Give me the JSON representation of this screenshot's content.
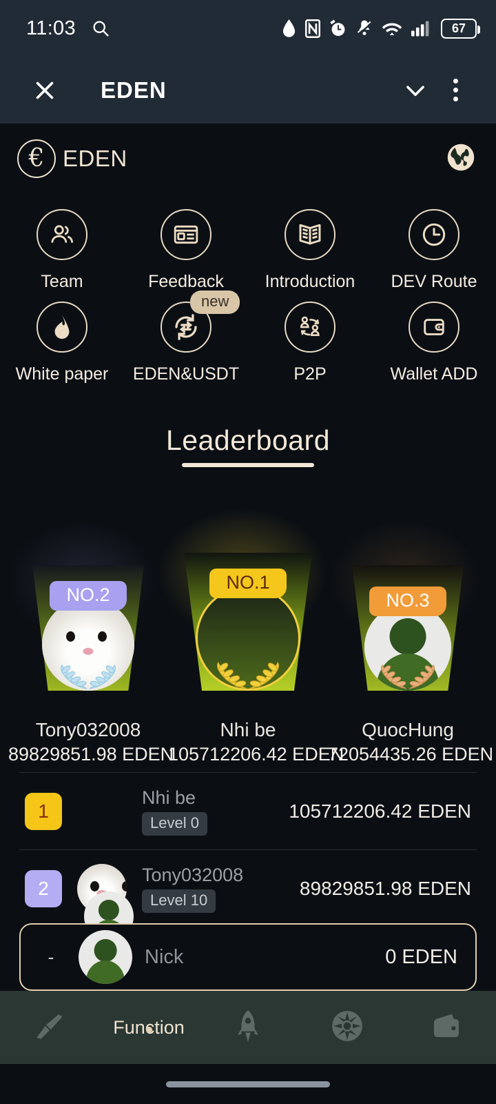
{
  "statusbar": {
    "time": "11:03",
    "search_icon": "search-icon",
    "icons": [
      "water-drop-icon",
      "nfc-icon",
      "alarm-clock-icon",
      "bell-muted-icon",
      "wifi-icon",
      "cellular-signal-icon"
    ],
    "battery_level": "67"
  },
  "window": {
    "close_label": "✕",
    "title": "EDEN",
    "chevron_icon": "chevron-down-icon",
    "menu_icon": "more-vertical-icon"
  },
  "appheader": {
    "logo_glyph": "€",
    "brand": "EDEN",
    "globe_icon": "globe-icon"
  },
  "grid": {
    "items": [
      {
        "label": "Team",
        "icon": "users-icon",
        "badge": ""
      },
      {
        "label": "Feedback",
        "icon": "form-card-icon",
        "badge": ""
      },
      {
        "label": "Introduction",
        "icon": "open-book-icon",
        "badge": ""
      },
      {
        "label": "DEV Route",
        "icon": "clock-icon",
        "badge": ""
      },
      {
        "label": "White paper",
        "icon": "flame-drop-icon",
        "badge": ""
      },
      {
        "label": "EDEN&USDT",
        "icon": "swap-refresh-icon",
        "badge": "new"
      },
      {
        "label": "P2P",
        "icon": "p2p-exchange-icon",
        "badge": ""
      },
      {
        "label": "Wallet ADD",
        "icon": "wallet-icon",
        "badge": ""
      }
    ]
  },
  "leaderboard": {
    "title": "Leaderboard",
    "podium": [
      {
        "tag": "NO.2",
        "name": "Tony032008",
        "amount": "89829851.98 EDEN",
        "avatar": "hamster-photo",
        "wreath": "silver-laurel-icon"
      },
      {
        "tag": "NO.1",
        "name": "Nhi be",
        "amount": "105712206.42 EDEN",
        "avatar": "empty-avatar",
        "wreath": "gold-laurel-icon"
      },
      {
        "tag": "NO.3",
        "name": "QuocHung",
        "amount": "72054435.26 EDEN",
        "avatar": "default-person-avatar",
        "wreath": "bronze-laurel-icon"
      }
    ],
    "rows": [
      {
        "rank": "1",
        "name": "Nhi be",
        "level": "Level 0",
        "amount": "105712206.42 EDEN",
        "avatar": "none"
      },
      {
        "rank": "2",
        "name": "Tony032008",
        "level": "Level 10",
        "amount": "89829851.98 EDEN",
        "avatar": "hamster-photo"
      }
    ],
    "self": {
      "rank": "-",
      "name": "Nick",
      "amount": "0 EDEN",
      "avatar": "default-person-avatar"
    }
  },
  "bottomnav": {
    "items": [
      {
        "label": "",
        "icon": "mining-pickaxe-icon",
        "active": false
      },
      {
        "label": "Function",
        "icon": "",
        "active": true
      },
      {
        "label": "",
        "icon": "rocket-icon",
        "active": false
      },
      {
        "label": "",
        "icon": "fan-wheel-icon",
        "active": false
      },
      {
        "label": "",
        "icon": "wallet-icon",
        "active": false
      }
    ]
  },
  "colors": {
    "chrome": "#212b36",
    "page_bg": "#0b0f14",
    "cream": "#f0e2cd",
    "gold": "#f5c518",
    "lavender": "#a7a1ef",
    "orange": "#f29b39",
    "nav_bg": "#2b3733"
  }
}
